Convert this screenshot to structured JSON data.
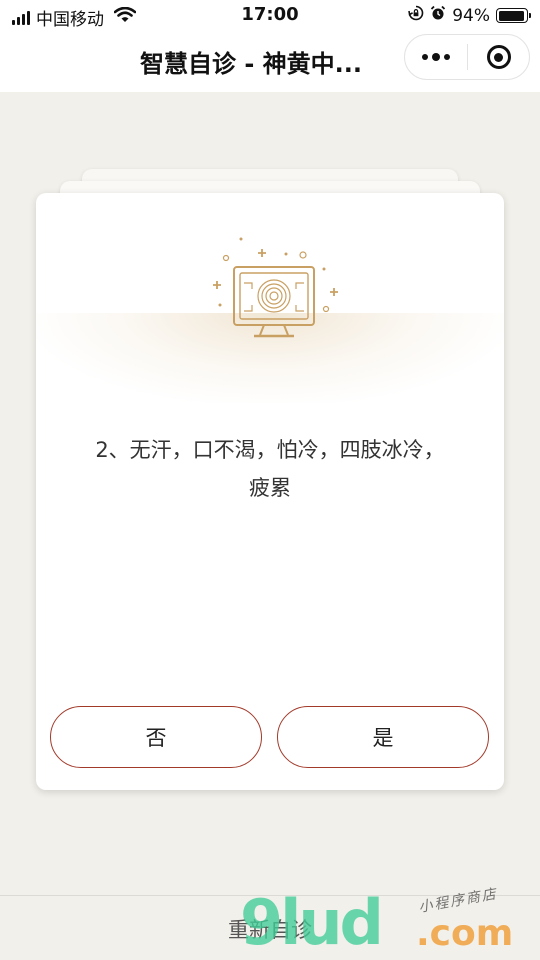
{
  "status_bar": {
    "carrier": "中国移动",
    "time": "17:00",
    "battery_percent": "94%",
    "battery_level": 0.94,
    "icons": [
      "signal-icon",
      "wifi-icon",
      "rotation-lock-icon",
      "alarm-icon",
      "battery-icon"
    ]
  },
  "nav": {
    "title": "智慧自诊 - 神黄中...",
    "more_icon": "more-dots-icon",
    "close_icon": "miniprogram-close-icon"
  },
  "card": {
    "illustration_icon": "diagnosis-monitor-icon",
    "question": "2、无汗，口不渴，怕冷，四肢冰冷，疲累",
    "no_label": "否",
    "yes_label": "是"
  },
  "footer": {
    "restart_label": "重新自诊"
  },
  "watermark": {
    "main": "9lud",
    "com": ".com",
    "tagline": "小程序商店"
  },
  "colors": {
    "background": "#f2f0ea",
    "button_border": "#a23a2a",
    "illustration": "#c9a063"
  }
}
